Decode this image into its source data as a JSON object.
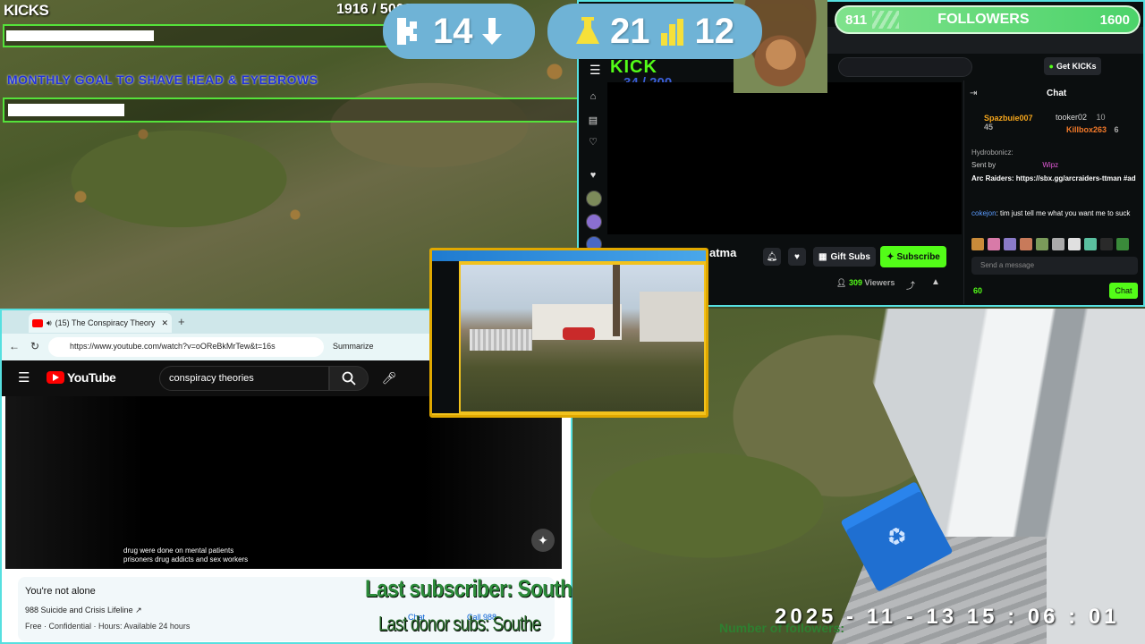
{
  "kicks_overlay": {
    "label": "KICKS",
    "progress_text": "1916  / 5000",
    "progress_fraction": 0.383
  },
  "goal_overlay": {
    "title": "MONTHLY GOAL TO SHAVE HEAD & EYEBROWS",
    "progress_fraction": 0.17
  },
  "counters": {
    "kicks_count": "14",
    "subs_count": "21",
    "gift_count": "12"
  },
  "followers": {
    "label": "FOLLOWERS",
    "current": "811",
    "goal": "1600"
  },
  "kick_window": {
    "logo": "KICK",
    "sub_count": "34  / 200",
    "get_kicks_label": "Get KICKs",
    "streamer_name": "atma",
    "gift_subs_label": "Gift Subs",
    "subscribe_label": "Subscribe",
    "viewers_count": "309",
    "viewers_label": "Viewers",
    "chat": {
      "title": "Chat",
      "top_gifter_1": "Spazbuie007",
      "top_gifter_1_count": "45",
      "top_gifter_2": "tooker02",
      "top_gifter_2_count": "10",
      "top_gifter_3": "Killbox263",
      "top_gifter_3_count": "6",
      "partial_user": "Hydrobonicz:",
      "sent_by_label": "Sent by",
      "sent_by_user": "Wipz",
      "ad_text": "Arc Raiders: https://sbx.gg/arcraiders-ttman #ad",
      "msg_user": "cokejon",
      "msg_text": ": tim just tell me what you want me to suck",
      "input_placeholder": "Send a message",
      "kicks_balance": "60",
      "send_label": "Chat"
    }
  },
  "youtube_window": {
    "tab_title": "(15) The Conspiracy Theory",
    "url": "https://www.youtube.com/watch?v=oOReBkMrTew&t=16s",
    "summarize_label": "Summarize",
    "logo_text": "YouTube",
    "search_value": "conspiracy theories",
    "caption_line1": "drug were done on mental patients",
    "caption_line2": "prisoners drug addicts and sex workers",
    "crisis": {
      "title": "You're not alone",
      "line": "988 Suicide and Crisis Lifeline ↗",
      "info": "Free · Confidential · Hours: Available 24 hours",
      "chat_label": "Chat",
      "call_label": "Call 988"
    }
  },
  "bottom_overlay": {
    "last_subscriber": "Last subscriber: South",
    "last_donor": "Last donor subs: Southe",
    "number_of_followers": "Number of followers:",
    "timestamp": "2025 - 11 - 13   15 : 06 : 01"
  },
  "colors": {
    "kick_green": "#53fc18",
    "overlay_green": "#55e23a",
    "goal_blue": "#2233d8",
    "pill_blue": "#6fb3d6",
    "webcam_yellow": "#f2c21d",
    "youtube_red": "#ff0000"
  }
}
